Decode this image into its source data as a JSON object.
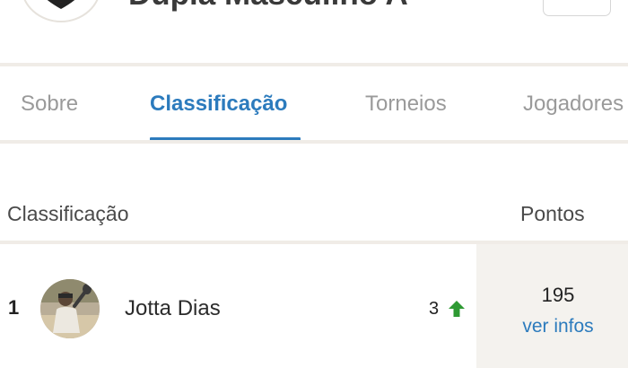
{
  "header": {
    "title": "Dupla Masculino A",
    "logo_icon": "team-shield-logo-icon",
    "accent": "#c0392b"
  },
  "tabs": [
    {
      "label": "Sobre",
      "active": false
    },
    {
      "label": "Classificação",
      "active": true
    },
    {
      "label": "Torneios",
      "active": false
    },
    {
      "label": "Jogadores",
      "active": false
    }
  ],
  "table": {
    "columns": {
      "ranking": "Classificação",
      "points": "Pontos"
    },
    "rows": [
      {
        "rank": "1",
        "name": "Jotta Dias",
        "change": "3",
        "change_icon": "arrow-up-icon",
        "points": "195",
        "details_link": "ver infos"
      }
    ]
  },
  "colors": {
    "link": "#2c7bbd",
    "positive": "#2e9a33",
    "divider": "#f0ece7",
    "points_bg": "#f4f2ee"
  }
}
